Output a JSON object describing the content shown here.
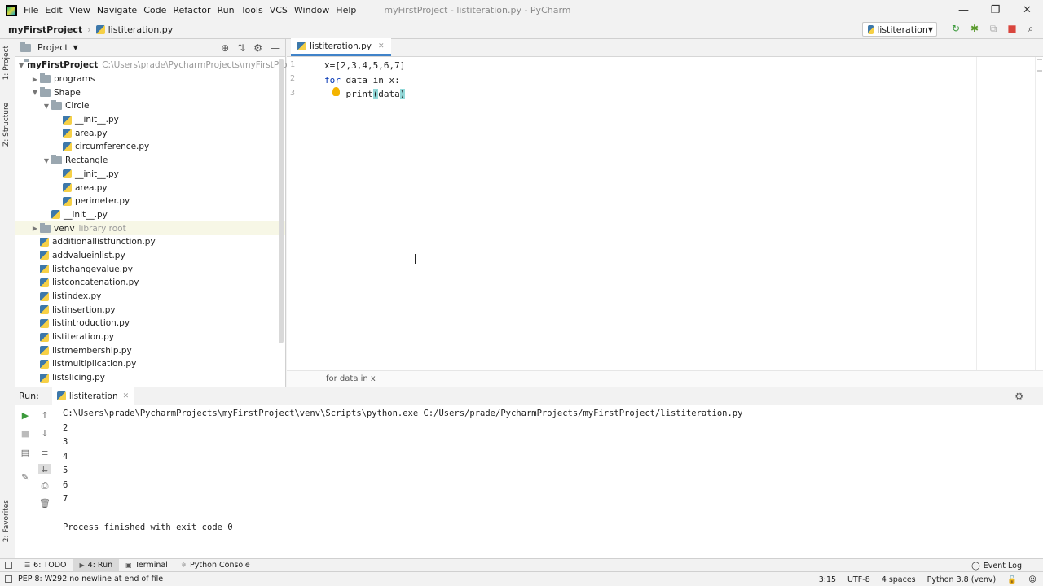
{
  "window": {
    "title": "myFirstProject - listiteration.py - PyCharm",
    "menu": [
      "File",
      "Edit",
      "View",
      "Navigate",
      "Code",
      "Refactor",
      "Run",
      "Tools",
      "VCS",
      "Window",
      "Help"
    ],
    "controls": {
      "minimize": "—",
      "restore": "❐",
      "close": "✕"
    }
  },
  "navbar": {
    "project": "myFirstProject",
    "file": "listiteration.py",
    "run_config": "listiteration"
  },
  "left_strip": {
    "project_tab": "1: Project",
    "structure_tab": "Z: Structure",
    "favorites_tab": "2: Favorites"
  },
  "project_panel": {
    "title": "Project",
    "tree": [
      {
        "indent": 0,
        "type": "folder",
        "open": true,
        "label": "myFirstProject",
        "hint": "C:\\Users\\prade\\PycharmProjects\\myFirstProject",
        "bold": true
      },
      {
        "indent": 1,
        "type": "folder",
        "open": false,
        "label": "programs",
        "hint": ""
      },
      {
        "indent": 1,
        "type": "folder",
        "open": true,
        "label": "Shape",
        "hint": ""
      },
      {
        "indent": 2,
        "type": "folder",
        "open": true,
        "label": "Circle",
        "hint": ""
      },
      {
        "indent": 3,
        "type": "file",
        "label": "__init__.py",
        "hint": ""
      },
      {
        "indent": 3,
        "type": "file",
        "label": "area.py",
        "hint": ""
      },
      {
        "indent": 3,
        "type": "file",
        "label": "circumference.py",
        "hint": ""
      },
      {
        "indent": 2,
        "type": "folder",
        "open": true,
        "label": "Rectangle",
        "hint": ""
      },
      {
        "indent": 3,
        "type": "file",
        "label": "__init__.py",
        "hint": ""
      },
      {
        "indent": 3,
        "type": "file",
        "label": "area.py",
        "hint": ""
      },
      {
        "indent": 3,
        "type": "file",
        "label": "perimeter.py",
        "hint": ""
      },
      {
        "indent": 2,
        "type": "file",
        "label": "__init__.py",
        "hint": ""
      },
      {
        "indent": 1,
        "type": "folder",
        "open": false,
        "label": "venv",
        "hint": "library root",
        "selected": true
      },
      {
        "indent": 1,
        "type": "file",
        "label": "additionallistfunction.py",
        "hint": ""
      },
      {
        "indent": 1,
        "type": "file",
        "label": "addvalueinlist.py",
        "hint": ""
      },
      {
        "indent": 1,
        "type": "file",
        "label": "listchangevalue.py",
        "hint": ""
      },
      {
        "indent": 1,
        "type": "file",
        "label": "listconcatenation.py",
        "hint": ""
      },
      {
        "indent": 1,
        "type": "file",
        "label": "listindex.py",
        "hint": ""
      },
      {
        "indent": 1,
        "type": "file",
        "label": "listinsertion.py",
        "hint": ""
      },
      {
        "indent": 1,
        "type": "file",
        "label": "listintroduction.py",
        "hint": ""
      },
      {
        "indent": 1,
        "type": "file",
        "label": "listiteration.py",
        "hint": ""
      },
      {
        "indent": 1,
        "type": "file",
        "label": "listmembership.py",
        "hint": ""
      },
      {
        "indent": 1,
        "type": "file",
        "label": "listmultiplication.py",
        "hint": ""
      },
      {
        "indent": 1,
        "type": "file",
        "label": "listslicing.py",
        "hint": ""
      }
    ]
  },
  "editor": {
    "tab": "listiteration.py",
    "line_numbers": [
      "1",
      "2",
      "3"
    ],
    "code": {
      "line1": "x=[2,3,4,5,6,7]",
      "line2_kw": "for",
      "line2_rest": " data in x:",
      "line3_fn": "print",
      "line3_arg": "data"
    },
    "breadcrumb": "for data in x"
  },
  "run_panel": {
    "label": "Run:",
    "tab": "listiteration",
    "output": [
      "C:\\Users\\prade\\PycharmProjects\\myFirstProject\\venv\\Scripts\\python.exe C:/Users/prade/PycharmProjects/myFirstProject/listiteration.py",
      "2",
      "3",
      "4",
      "5",
      "6",
      "7",
      "",
      "Process finished with exit code 0"
    ]
  },
  "bottom_tabs": {
    "todo": "6: TODO",
    "run": "4: Run",
    "terminal": "Terminal",
    "python_console": "Python Console",
    "event_log": "Event Log"
  },
  "status_bar": {
    "message": "PEP 8: W292 no newline at end of file",
    "position": "3:15",
    "encoding": "UTF-8",
    "indent": "4 spaces",
    "interpreter": "Python 3.8 (venv)"
  }
}
